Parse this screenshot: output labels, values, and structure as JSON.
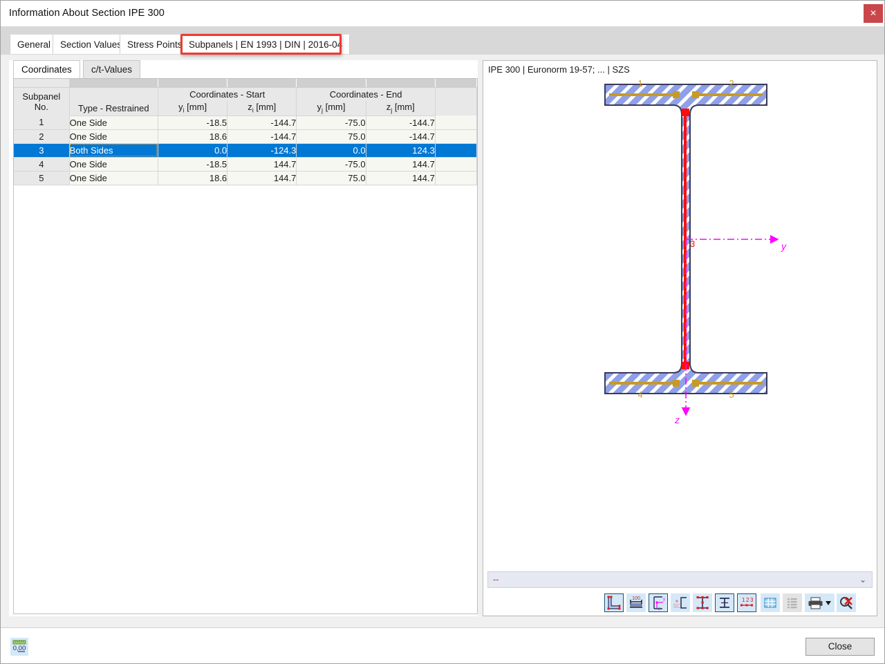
{
  "window": {
    "title": "Information About Section IPE 300",
    "close_icon": "close-icon",
    "close_label": "✕"
  },
  "tabs": [
    {
      "label": "General",
      "active": false
    },
    {
      "label": "Section Values",
      "active": false
    },
    {
      "label": "Stress Points",
      "active": false
    },
    {
      "label": "Subpanels | EN 1993 | DIN | 2016-04",
      "active": true
    }
  ],
  "annotation": {
    "color": "#ee3a32",
    "target_tab": "Subpanels | EN 1993 | DIN | 2016-04"
  },
  "subtabs": [
    {
      "label": "Coordinates",
      "active": true
    },
    {
      "label": "c/t-Values",
      "active": false
    }
  ],
  "table": {
    "group_headers": [
      {
        "label": "",
        "span": 1
      },
      {
        "label": "",
        "span": 1
      },
      {
        "label": "Coordinates - Start",
        "span": 2
      },
      {
        "label": "Coordinates - End",
        "span": 2
      },
      {
        "label": "",
        "span": 1
      }
    ],
    "columns": [
      {
        "line1": "Subpanel",
        "line2": "No."
      },
      {
        "line1": "",
        "line2": "Type - Restrained"
      },
      {
        "line1": "",
        "line2": "yi [mm]",
        "base": "y",
        "sub": "i",
        "unit": " [mm]"
      },
      {
        "line1": "",
        "line2": "zi [mm]",
        "base": "z",
        "sub": "i",
        "unit": " [mm]"
      },
      {
        "line1": "",
        "line2": "yj [mm]",
        "base": "y",
        "sub": "j",
        "unit": " [mm]"
      },
      {
        "line1": "",
        "line2": "zj [mm]",
        "base": "z",
        "sub": "j",
        "unit": " [mm]"
      },
      {
        "line1": "",
        "line2": ""
      }
    ],
    "rows": [
      {
        "no": "1",
        "type": "One Side",
        "yi": "-18.5",
        "zi": "-144.7",
        "yj": "-75.0",
        "zj": "-144.7",
        "selected": false
      },
      {
        "no": "2",
        "type": "One Side",
        "yi": "18.6",
        "zi": "-144.7",
        "yj": "75.0",
        "zj": "-144.7",
        "selected": false
      },
      {
        "no": "3",
        "type": "Both Sides",
        "yi": "0.0",
        "zi": "-124.3",
        "yj": "0.0",
        "zj": "124.3",
        "selected": true
      },
      {
        "no": "4",
        "type": "One Side",
        "yi": "-18.5",
        "zi": "144.7",
        "yj": "-75.0",
        "zj": "144.7",
        "selected": false
      },
      {
        "no": "5",
        "type": "One Side",
        "yi": "18.6",
        "zi": "144.7",
        "yj": "75.0",
        "zj": "144.7",
        "selected": false
      }
    ],
    "selection_color": "#0078d4"
  },
  "viewer": {
    "caption": "IPE 300 | Euronorm 19-57; ... | SZS",
    "combo_value": "--",
    "combo_chevron": "chevron-down-icon",
    "drawing": {
      "section_name": "IPE 300",
      "subpanel_labels": [
        "1",
        "2",
        "3",
        "4",
        "5"
      ],
      "axis_y_label": "y",
      "axis_z_label": "z",
      "selected_subpanel": "3",
      "fill_color": "#8fa0e8",
      "hatch_color": "#ffffff",
      "outline_color": "#3a3a5a",
      "subpanel_color": "#c79a26",
      "selected_color": "#fa0f0f",
      "axis_color": "#ff00ff"
    },
    "toolbar": [
      {
        "name": "section-shape-button",
        "framed": true,
        "disabled": false
      },
      {
        "name": "dimensions-button",
        "framed": false,
        "disabled": false
      },
      {
        "name": "axes-origin-button",
        "framed": true,
        "disabled": false
      },
      {
        "name": "shear-center-button",
        "framed": false,
        "disabled": false
      },
      {
        "name": "stress-points-button",
        "framed": false,
        "disabled": false
      },
      {
        "name": "parts-button",
        "framed": true,
        "disabled": false
      },
      {
        "name": "numbering-button",
        "framed": true,
        "disabled": false
      },
      {
        "name": "grid-button",
        "framed": false,
        "disabled": false
      },
      {
        "name": "list-button",
        "framed": false,
        "disabled": true
      },
      {
        "name": "print-button",
        "framed": false,
        "disabled": false
      },
      {
        "name": "clear-selection-button",
        "framed": false,
        "disabled": false
      }
    ]
  },
  "footer": {
    "units_button_name": "units-decimal-places-button",
    "units_value": "0,00",
    "close_label": "Close"
  }
}
